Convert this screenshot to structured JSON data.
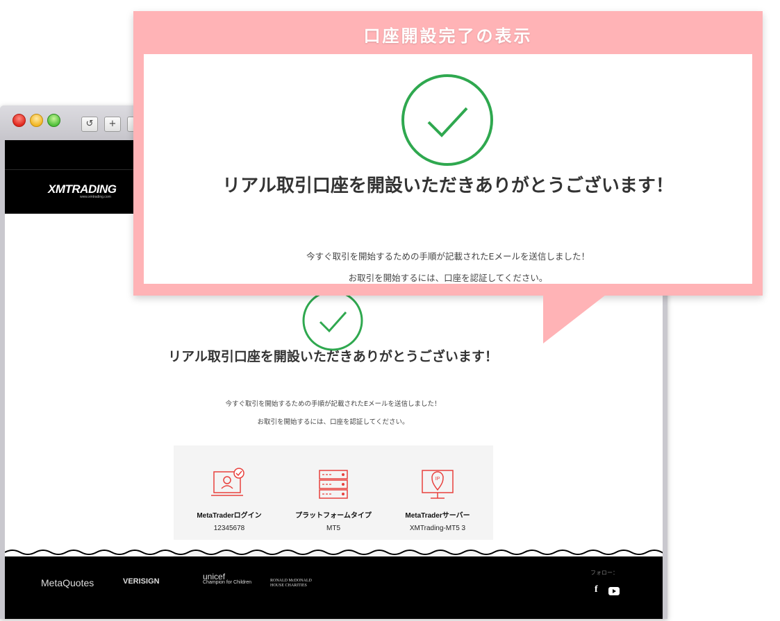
{
  "callout": {
    "title": "口座開設完了の表示",
    "heading": "リアル取引口座を開設いただきありがとうございます！",
    "line1": "今すぐ取引を開始するための手順が記載されたEメールを送信しました！",
    "line2": "お取引を開始するには、口座を認証してください。"
  },
  "browser": {
    "toolbar": {
      "reload_icon": "↺",
      "newtab_icon": "+"
    }
  },
  "site": {
    "logo": "XMTRADING",
    "logo_sub": "www.xmtrading.com",
    "heading": "リアル取引口座を開設いただきありがとうございます！",
    "line1": "今すぐ取引を開始するための手順が記載されたEメールを送信しました！",
    "line2": "お取引を開始するには、口座を認証してください。",
    "info": [
      {
        "label": "MetaTraderログイン",
        "value": "12345678",
        "icon": "laptop-user-icon"
      },
      {
        "label": "プラットフォームタイプ",
        "value": "MT5",
        "icon": "server-icon"
      },
      {
        "label": "MetaTraderサーバー",
        "value": "XMTrading-MT5 3",
        "icon": "monitor-ip-icon"
      }
    ],
    "footer": {
      "partners": [
        "MetaQuotes",
        "VERISIGN",
        "unicef",
        "Champion for Children",
        "RONALD McDONALD HOUSE CHARITIES"
      ],
      "follow_label": "フォロー：",
      "social": [
        "facebook-icon",
        "youtube-icon"
      ]
    }
  },
  "colors": {
    "callout_bg": "#ffb3b6",
    "success_green": "#2fa84f",
    "icon_red": "#e8403c"
  }
}
